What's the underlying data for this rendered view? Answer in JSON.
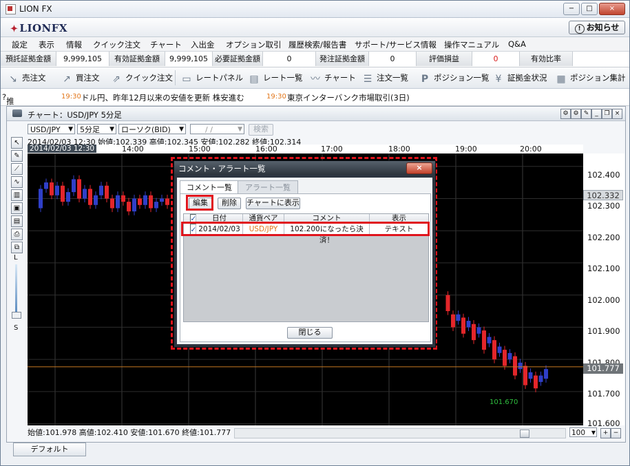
{
  "window": {
    "title": "LION FX",
    "controls": [
      "−",
      "□",
      "×"
    ]
  },
  "header": {
    "logo": "LIONFX",
    "notice_label": "お知らせ"
  },
  "menu": [
    "設定",
    "表示",
    "情報",
    "クイック注文",
    "チャート",
    "入出金",
    "オプション取引",
    "履歴検索/報告書",
    "サポート/サービス情報",
    "操作マニュアル",
    "Q&A"
  ],
  "account": {
    "cells": [
      {
        "label": "預託証拠金額",
        "value": "9,999,105"
      },
      {
        "label": "有効証拠金額",
        "value": "9,999,105"
      },
      {
        "label": "必要証拠金額",
        "value": "0"
      },
      {
        "label": "発注証拠金額",
        "value": "0"
      },
      {
        "label": "評価損益",
        "value": "0"
      },
      {
        "label": "有効比率",
        "value": ""
      }
    ],
    "loss_color": "#d81c1c"
  },
  "toolbar": [
    {
      "label": "売注文",
      "icon": "sell-arrow-icon"
    },
    {
      "label": "買注文",
      "icon": "buy-arrow-icon"
    },
    {
      "label": "クイック注文",
      "icon": "quick-order-icon"
    },
    {
      "label": "レートパネル",
      "icon": "rate-panel-icon"
    },
    {
      "label": "レート一覧",
      "icon": "rate-list-icon"
    },
    {
      "label": "チャート",
      "icon": "chart-icon"
    },
    {
      "label": "注文一覧",
      "icon": "order-list-icon"
    },
    {
      "label": "ポジション一覧",
      "icon": "position-list-icon"
    },
    {
      "label": "証拠金状況",
      "icon": "margin-icon"
    },
    {
      "label": "ポジション集計",
      "icon": "position-summary-icon"
    }
  ],
  "ticker": {
    "prefix": "推移",
    "items": [
      {
        "time": "19:30",
        "text": "ドル円、昨年12月以来の安値を更新  株安進む"
      },
      {
        "time": "19:30",
        "text": "東京インターバンク市場取引(3日)"
      }
    ]
  },
  "chart_window": {
    "title": "チャート：USD/JPY 5分足",
    "pair": "USD/JPY",
    "timeframe": "5分足",
    "candle_type": "ローソク(BID)",
    "date_placeholder": "/ /",
    "search_label": "検索",
    "ohlc_top": "2014/02/03 12:30  始値:102.339   高値:102.345   安値:102.282   終値:102.314",
    "time_badge": "2014/02/03 12:30",
    "time_labels": [
      "14:00",
      "15:00",
      "16:00",
      "17:00",
      "18:00",
      "19:00",
      "20:00"
    ],
    "price_labels": [
      "102.400",
      "102.300",
      "102.200",
      "102.100",
      "102.000",
      "101.900",
      "101.800",
      "101.700",
      "101.600"
    ],
    "current_price": "102.332",
    "last_price": "101.777",
    "low_label": "101.670",
    "ohlc_bottom": "始値:101.978   高値:102.410   安値:101.670   終値:101.777",
    "zoom": "100",
    "left_tool_letters": {
      "large": "L",
      "small": "S"
    },
    "colors": {
      "up": "#2f3fc8",
      "down": "#e3262a",
      "price_line": "#c87a22",
      "low_label": "#2fbf3f"
    }
  },
  "tabs": {
    "default": "デフォルト"
  },
  "dialog": {
    "title": "コメント・アラート一覧",
    "close_x": "×",
    "tabs": [
      "コメント一覧",
      "アラート一覧"
    ],
    "buttons": {
      "edit": "編集",
      "delete": "削除",
      "show_chart": "チャートに表示"
    },
    "columns": [
      "",
      "日付",
      "通貨ペア",
      "コメント",
      "表示"
    ],
    "rows": [
      {
        "checked": true,
        "date": "2014/02/03",
        "pair": "USD/JPY",
        "comment": "102.200になったら決済！",
        "display": "テキスト"
      }
    ],
    "close_label": "閉じる",
    "pair_color": "#e2761a"
  }
}
